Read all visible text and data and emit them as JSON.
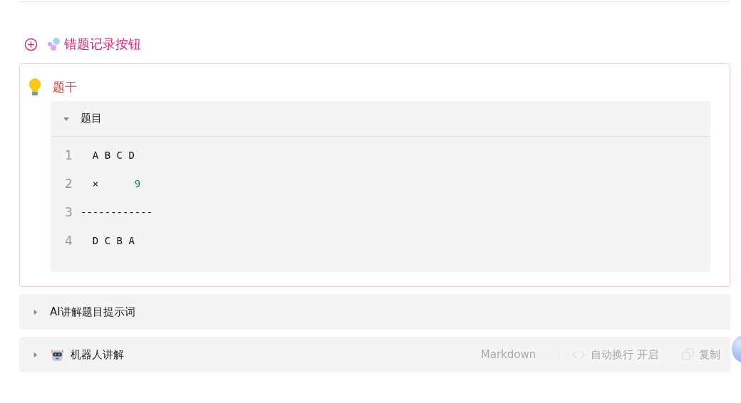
{
  "header": {
    "title": "错题记录按钮"
  },
  "callout": {
    "title": "题干",
    "code_block": {
      "title": "题目",
      "expanded": true,
      "lines": [
        {
          "number": "1",
          "tokens": [
            {
              "text": "  A B C D",
              "kind": "plain"
            }
          ]
        },
        {
          "number": "2",
          "tokens": [
            {
              "text": "  ×      ",
              "kind": "plain"
            },
            {
              "text": "9",
              "kind": "number"
            }
          ]
        },
        {
          "number": "3",
          "tokens": [
            {
              "text": "------------",
              "kind": "plain"
            }
          ]
        },
        {
          "number": "4",
          "tokens": [
            {
              "text": "  D C B A",
              "kind": "plain"
            }
          ]
        }
      ]
    }
  },
  "toggles": [
    {
      "label": "AI讲解题目提示词",
      "expanded": false,
      "kind": "plain"
    },
    {
      "label": "机器人讲解",
      "expanded": false,
      "kind": "robot",
      "toolbar": {
        "language": "Markdown",
        "wrap": "自动换行 开启",
        "copy": "复制"
      }
    }
  ]
}
